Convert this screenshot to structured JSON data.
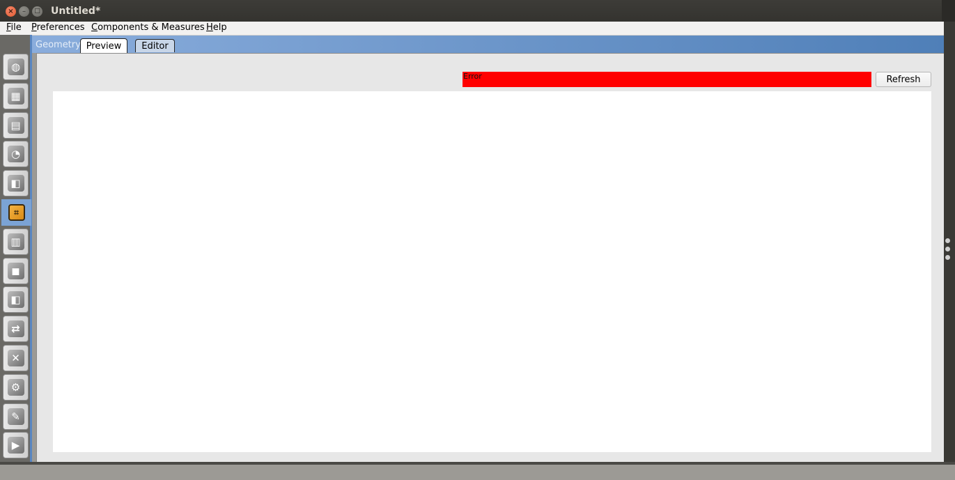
{
  "window": {
    "title": "Untitled*",
    "close_glyph": "×",
    "min_glyph": "–",
    "max_glyph": "□"
  },
  "menu": {
    "items": [
      {
        "pre": "",
        "accel": "F",
        "post": "ile"
      },
      {
        "pre": "",
        "accel": "P",
        "post": "references"
      },
      {
        "pre": "",
        "accel": "C",
        "post": "omponents & Measures"
      },
      {
        "pre": "",
        "accel": "H",
        "post": "elp"
      }
    ]
  },
  "sidebar": {
    "icons": [
      "site-globe-icon",
      "schedules-calendar-icon",
      "constructions-bricks-icon",
      "loads-outlet-icon",
      "space-types-cube-icon",
      "geometry-floorplan-icon",
      "facility-building-icon",
      "spaces-box-icon",
      "thermal-zones-cube-icon",
      "hvac-systems-loop-icon",
      "variables-x-icon",
      "simulation-settings-gear-icon",
      "measures-scroll-icon",
      "run-simulation-play-icon"
    ],
    "active_index": 5,
    "glyphs": [
      "◍",
      "▦",
      "▤",
      "◔",
      "◧",
      "⌗",
      "▥",
      "◼",
      "◧",
      "⇄",
      "✕",
      "⚙",
      "✎",
      "▶"
    ]
  },
  "tabs": {
    "section": "Geometry",
    "items": [
      "Preview",
      "Editor"
    ],
    "selected": "Preview"
  },
  "preview": {
    "error_text": "Error",
    "error_color": "#ff0000",
    "refresh_label": "Refresh"
  }
}
